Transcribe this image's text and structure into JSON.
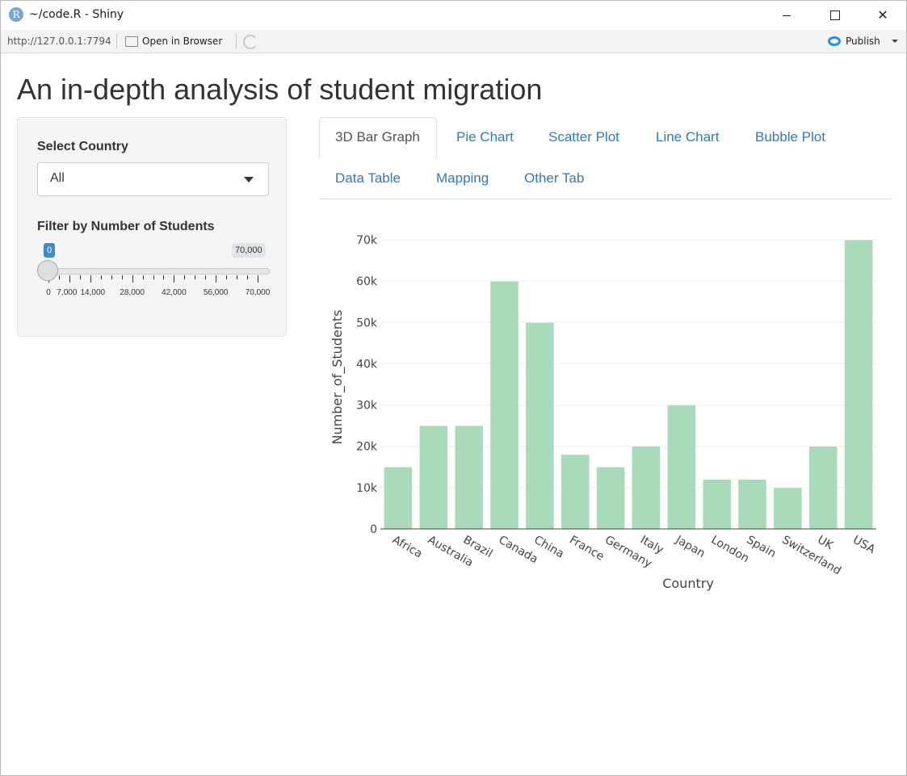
{
  "window": {
    "title": "~/code.R - Shiny",
    "logo_letter": "R",
    "minimize_icon": "minimize-icon",
    "maximize_icon": "maximize-icon",
    "close_icon": "close-icon"
  },
  "toolbar": {
    "url": "http://127.0.0.1:7794",
    "open_in_browser": "Open in Browser",
    "publish": "Publish"
  },
  "app": {
    "title": "An in-depth analysis of student migration"
  },
  "sidebar": {
    "select_label": "Select Country",
    "select_value": "All",
    "slider_label": "Filter by Number of Students",
    "slider_min_value": "0",
    "slider_max_value": "70,000",
    "slider_ticks": [
      "0",
      "7,000",
      "14,000",
      "28,000",
      "42,000",
      "56,000",
      "70,000"
    ]
  },
  "tabs": [
    {
      "label": "3D Bar Graph",
      "active": true
    },
    {
      "label": "Pie Chart",
      "active": false
    },
    {
      "label": "Scatter Plot",
      "active": false
    },
    {
      "label": "Line Chart",
      "active": false
    },
    {
      "label": "Bubble Plot",
      "active": false
    },
    {
      "label": "Data Table",
      "active": false
    },
    {
      "label": "Mapping",
      "active": false
    },
    {
      "label": "Other Tab",
      "active": false
    }
  ],
  "chart_data": {
    "type": "bar",
    "categories": [
      "Africa",
      "Australia",
      "Brazil",
      "Canada",
      "China",
      "France",
      "Germany",
      "Italy",
      "Japan",
      "London",
      "Spain",
      "Switzerland",
      "UK",
      "USA"
    ],
    "values": [
      15000,
      25000,
      25000,
      60000,
      50000,
      18000,
      15000,
      20000,
      30000,
      12000,
      12000,
      10000,
      20000,
      70000
    ],
    "xlabel": "Country",
    "ylabel": "Number_of_Students",
    "ylim": [
      0,
      70000
    ],
    "y_ticks": [
      0,
      10000,
      20000,
      30000,
      40000,
      50000,
      60000,
      70000
    ],
    "y_tick_labels": [
      "0",
      "10k",
      "20k",
      "30k",
      "40k",
      "50k",
      "60k",
      "70k"
    ],
    "bar_color": "#a9dbbb",
    "grid": true
  }
}
